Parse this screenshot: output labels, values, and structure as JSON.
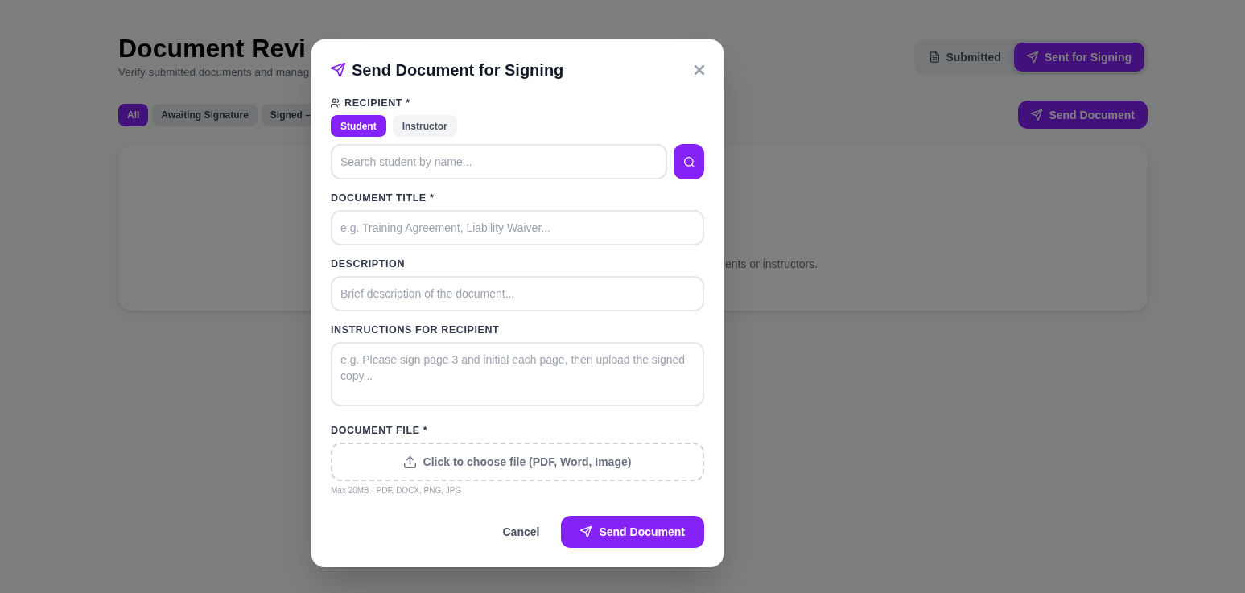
{
  "page": {
    "title": "Document Revi",
    "subtitle": "Verify submitted documents and manag",
    "view_toggle": [
      {
        "kind": "submitted",
        "label": "Submitted",
        "selected": false
      },
      {
        "kind": "signing",
        "label": "Sent for Signing",
        "selected": true
      }
    ],
    "filters": [
      {
        "label": "All",
        "selected": true
      },
      {
        "label": "Awaiting Signature",
        "selected": false
      },
      {
        "label": "Signed –",
        "selected": false
      }
    ],
    "send_button": {
      "label": "Send Document"
    },
    "empty_state": {
      "text": "ents or instructors."
    }
  },
  "dialog": {
    "title": "Send Document for Signing",
    "recipient": {
      "label": "RECIPIENT *",
      "types": [
        {
          "label": "Student",
          "selected": true
        },
        {
          "label": "Instructor",
          "selected": false
        }
      ],
      "search": {
        "placeholder": "Search student by name..."
      }
    },
    "fields": [
      {
        "kind": "input",
        "label": "DOCUMENT TITLE *",
        "placeholder": "e.g. Training Agreement, Liability Waiver..."
      },
      {
        "kind": "input",
        "label": "DESCRIPTION",
        "placeholder": "Brief description of the document..."
      },
      {
        "kind": "textarea",
        "label": "INSTRUCTIONS FOR RECIPIENT",
        "placeholder": "e.g. Please sign page 3 and initial each page, then upload the signed copy..."
      },
      {
        "kind": "file",
        "label": "DOCUMENT FILE *",
        "prompt": "Click to choose file (PDF, Word, Image)",
        "hint": "Max 20MB · PDF, DOCX, PNG, JPG"
      }
    ],
    "buttons": [
      {
        "kind": "secondary",
        "label": "Cancel"
      },
      {
        "kind": "primary",
        "label": "Send Document"
      }
    ]
  }
}
